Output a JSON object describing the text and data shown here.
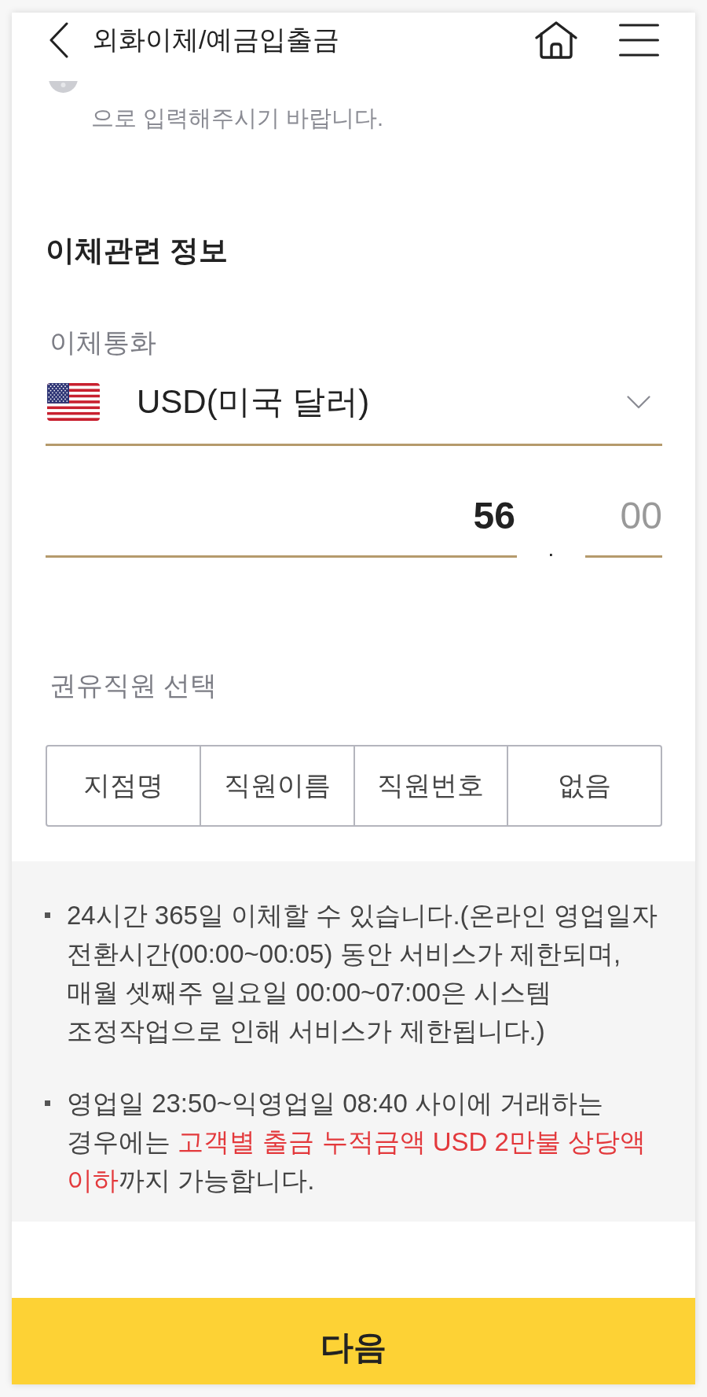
{
  "header": {
    "title": "외화이체/예금입출금"
  },
  "info_note": {
    "text": "으로 입력해주시기 바랍니다."
  },
  "transfer_info": {
    "title": "이체관련 정보",
    "currency": {
      "label": "이체통화",
      "value": "USD(미국 달러)"
    },
    "amount": {
      "integer": {
        "value": "56"
      },
      "separator": ".",
      "decimal": {
        "placeholder": "00"
      }
    },
    "recommender": {
      "label": "권유직원 선택",
      "options": [
        {
          "label": "지점명",
          "selected": false
        },
        {
          "label": "직원이름",
          "selected": false
        },
        {
          "label": "직원번호",
          "selected": false
        },
        {
          "label": "없음",
          "selected": false
        }
      ]
    }
  },
  "notices": [
    {
      "parts": [
        {
          "text": "24시간 365일 이체할 수 있습니다.(온라인 영업일자 전환시간(00:00~00:05) 동안 서비스가 제한되며, 매월 셋째주 일요일 00:00~07:00은 시스템 조정작업으로 인해 서비스가 제한됩니다.)",
          "highlight": false
        }
      ]
    },
    {
      "parts": [
        {
          "text": "영업일 23:50~익영업일 08:40 사이에 거래하는 경우에는 ",
          "highlight": false
        },
        {
          "text": "고객별 출금 누적금액 USD 2만불 상당액 이하",
          "highlight": true
        },
        {
          "text": "까지 가능합니다.",
          "highlight": false
        }
      ]
    }
  ],
  "next_button": {
    "label": "다음"
  }
}
